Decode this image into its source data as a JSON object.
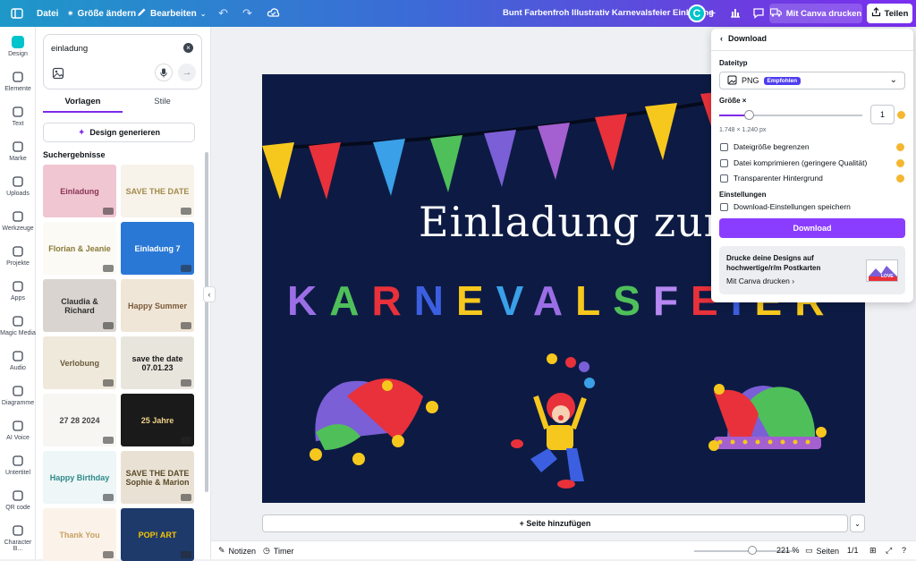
{
  "topbar": {
    "file_label": "Datei",
    "resize_label": "Größe ändern",
    "edit_label": "Bearbeiten",
    "title": "Bunt Farbenfroh Illustrativ Karnevalsfeier Einladung",
    "avatar_letter": "C",
    "print_label": "Mit Canva drucken",
    "share_label": "Teilen"
  },
  "rail": {
    "items": [
      {
        "label": "Design",
        "icon": "design-icon"
      },
      {
        "label": "Elemente",
        "icon": "elements-icon"
      },
      {
        "label": "Text",
        "icon": "text-icon"
      },
      {
        "label": "Marke",
        "icon": "brand-icon"
      },
      {
        "label": "Uploads",
        "icon": "upload-icon"
      },
      {
        "label": "Werkzeuge",
        "icon": "tools-icon"
      },
      {
        "label": "Projekte",
        "icon": "folder-icon"
      },
      {
        "label": "Apps",
        "icon": "apps-icon"
      },
      {
        "label": "Magic Media",
        "icon": "magic-media-icon"
      },
      {
        "label": "Audio",
        "icon": "audio-icon"
      },
      {
        "label": "Diagramme",
        "icon": "chart-icon"
      },
      {
        "label": "AI Voice",
        "icon": "ai-voice-icon"
      },
      {
        "label": "Untertitel",
        "icon": "subtitles-icon"
      },
      {
        "label": "QR code",
        "icon": "qr-icon"
      },
      {
        "label": "Character B...",
        "icon": "character-icon"
      }
    ]
  },
  "panel": {
    "search_value": "einladung",
    "tab_templates": "Vorlagen",
    "tab_styles": "Stile",
    "generate_label": "Design generieren",
    "results_title": "Suchergebnisse",
    "thumbs": [
      {
        "text": "Einladung",
        "bg": "#f1c6d3",
        "fg": "#8a3454"
      },
      {
        "text": "SAVE THE DATE",
        "bg": "#f7f3ea",
        "fg": "#a48b4c"
      },
      {
        "text": "Florian & Jeanie",
        "bg": "#fbfaf4",
        "fg": "#8a7a3a"
      },
      {
        "text": "Einladung 7",
        "bg": "#2a78d6",
        "fg": "#ffffff"
      },
      {
        "text": "Claudia & Richard",
        "bg": "#d9d4cf",
        "fg": "#2e2e2e"
      },
      {
        "text": "Happy Summer",
        "bg": "#f0e6d8",
        "fg": "#7a5a3a"
      },
      {
        "text": "Verlobung",
        "bg": "#efe9dc",
        "fg": "#6b5a3a"
      },
      {
        "text": "save the date 07.01.23",
        "bg": "#e8e5dd",
        "fg": "#1a1a1a"
      },
      {
        "text": "27 28 2024",
        "bg": "#f7f6f2",
        "fg": "#444444"
      },
      {
        "text": "25 Jahre",
        "bg": "#1a1a1a",
        "fg": "#f0d28a"
      },
      {
        "text": "Happy Birthday",
        "bg": "#eef6f7",
        "fg": "#2f8a8a"
      },
      {
        "text": "SAVE THE DATE Sophie & Marion",
        "bg": "#e9e2d4",
        "fg": "#5a4a2a"
      },
      {
        "text": "Thank You",
        "bg": "#fbf3ea",
        "fg": "#c8a062"
      },
      {
        "text": "POP! ART",
        "bg": "#1e3a6b",
        "fg": "#f7c600"
      }
    ]
  },
  "canvas": {
    "headline": "Einladung zur",
    "subhead_letters": [
      {
        "ch": "K",
        "color": "#9b6ee6"
      },
      {
        "ch": "A",
        "color": "#4fbf5a"
      },
      {
        "ch": "R",
        "color": "#e8313a"
      },
      {
        "ch": "N",
        "color": "#3b5fe0"
      },
      {
        "ch": "E",
        "color": "#f6c81d"
      },
      {
        "ch": "V",
        "color": "#3aa0e8"
      },
      {
        "ch": "A",
        "color": "#9b6ee6"
      },
      {
        "ch": "L",
        "color": "#f6c81d"
      },
      {
        "ch": "S",
        "color": "#4fbf5a"
      },
      {
        "ch": "F",
        "color": "#b787f2"
      },
      {
        "ch": "E",
        "color": "#e8313a"
      },
      {
        "ch": "I",
        "color": "#3b5fe0"
      },
      {
        "ch": "E",
        "color": "#f6c81d"
      },
      {
        "ch": "R",
        "color": "#f6c81d"
      }
    ],
    "pennant_colors": [
      "#f6c81d",
      "#e8313a",
      "#3aa0e8",
      "#4fbf5a",
      "#7b5fd6",
      "#a45fd0",
      "#e8313a",
      "#f6c81d",
      "#e8313a",
      "#3aa0e8"
    ]
  },
  "add_page_label": "+ Seite hinzufügen",
  "bottombar": {
    "notes_label": "Notizen",
    "timer_label": "Timer",
    "zoom_label": "221 %",
    "pages_label": "Seiten",
    "page_count": "1/1"
  },
  "download": {
    "title": "Download",
    "filetype_label": "Dateityp",
    "filetype_value": "PNG",
    "recommended_badge": "Empfohlen",
    "size_label": "Größe ×",
    "size_value": "1",
    "dimensions": "1.748 × 1.240 px",
    "options": [
      {
        "label": "Dateigröße begrenzen",
        "pro": true
      },
      {
        "label": "Datei komprimieren (geringere Qualität)",
        "pro": true
      },
      {
        "label": "Transparenter Hintergrund",
        "pro": true
      }
    ],
    "settings_label": "Einstellungen",
    "save_settings_label": "Download-Einstellungen speichern",
    "download_button": "Download",
    "promo_text": "Drucke deine Designs auf hochwertige/r/m Postkarten",
    "promo_link": "Mit Canva drucken",
    "promo_thumb_text": "LOVE"
  },
  "colors": {
    "accent": "#8b3dff",
    "canvas_bg": "#0d1b44"
  }
}
